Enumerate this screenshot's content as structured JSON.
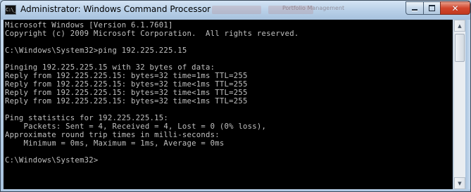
{
  "window": {
    "title": "Administrator: Windows Command Processor",
    "icon_name": "cmd-icon",
    "icon_text": "C:\\_",
    "background_tab_text": "Portfolio Management",
    "buttons": {
      "minimize": "minimize-icon",
      "maximize": "maximize-icon",
      "close": "close-icon"
    }
  },
  "console": {
    "text_color": "#c0c0c0",
    "background_color": "#000000",
    "lines": [
      "Microsoft Windows [Version 6.1.7601]",
      "Copyright (c) 2009 Microsoft Corporation.  All rights reserved.",
      "",
      "C:\\Windows\\System32>ping 192.225.225.15",
      "",
      "Pinging 192.225.225.15 with 32 bytes of data:",
      "Reply from 192.225.225.15: bytes=32 time=1ms TTL=255",
      "Reply from 192.225.225.15: bytes=32 time<1ms TTL=255",
      "Reply from 192.225.225.15: bytes=32 time<1ms TTL=255",
      "Reply from 192.225.225.15: bytes=32 time<1ms TTL=255",
      "",
      "Ping statistics for 192.225.225.15:",
      "    Packets: Sent = 4, Received = 4, Lost = 0 (0% loss),",
      "Approximate round trip times in milli-seconds:",
      "    Minimum = 0ms, Maximum = 1ms, Average = 0ms",
      "",
      "C:\\Windows\\System32>"
    ]
  },
  "scrollbar": {
    "up_icon": "scroll-up-arrow-icon",
    "down_icon": "scroll-down-arrow-icon"
  }
}
